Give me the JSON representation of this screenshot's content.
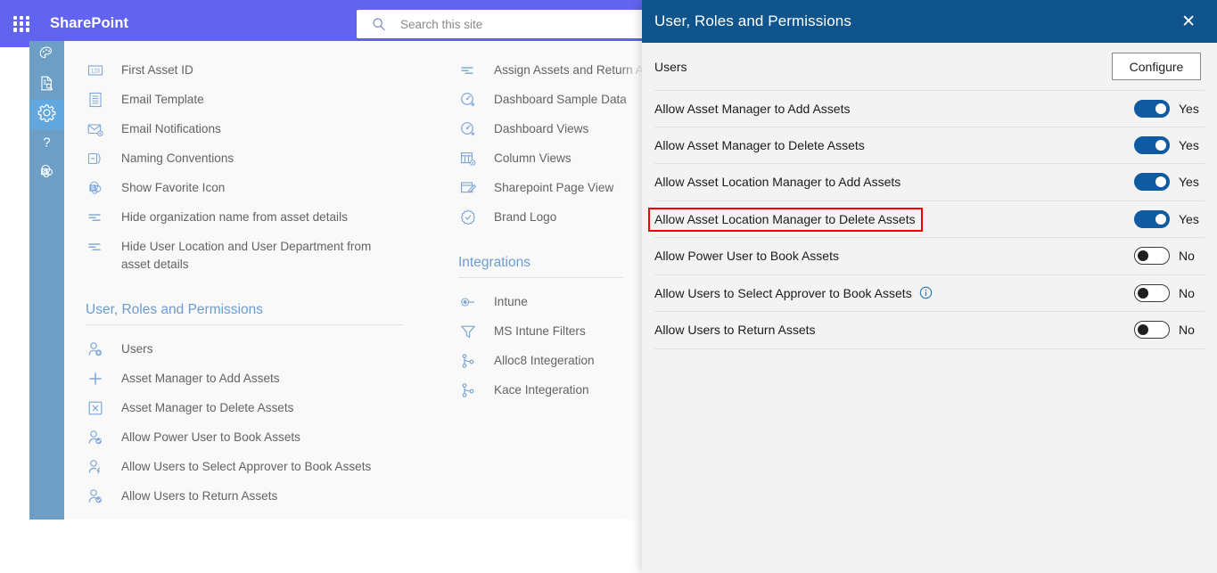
{
  "suite": {
    "waffle_label": "app-launcher",
    "brand": "SharePoint",
    "search_placeholder": "Search this site",
    "search_value": ""
  },
  "rail": {
    "items": [
      {
        "name": "theme-palette-icon",
        "label": "Theme"
      },
      {
        "name": "document-search-icon",
        "label": "Reports"
      },
      {
        "name": "gear-icon",
        "label": "Settings",
        "active": true
      },
      {
        "name": "question-mark-icon",
        "label": "Help"
      },
      {
        "name": "sharepoint-icon",
        "label": "SharePoint"
      }
    ]
  },
  "settings": {
    "column_a": {
      "items_top": [
        {
          "icon": "number-123-icon",
          "label": "First Asset ID"
        },
        {
          "icon": "email-template-icon",
          "label": "Email Template"
        },
        {
          "icon": "email-settings-icon",
          "label": "Email Notifications"
        },
        {
          "icon": "naming-conventions-icon",
          "label": "Naming Conventions"
        },
        {
          "icon": "sharepoint-favorite-icon",
          "label": "Show Favorite Icon"
        },
        {
          "icon": "hide-lines-icon",
          "label": "Hide organization name from asset details"
        },
        {
          "icon": "hide-lines-icon",
          "label": "Hide User Location and User Department from asset details",
          "wrap": true
        }
      ],
      "group_title": "User, Roles and Permissions",
      "items_group": [
        {
          "icon": "user-add-icon",
          "label": "Users"
        },
        {
          "icon": "plus-icon",
          "label": "Asset Manager to Add Assets"
        },
        {
          "icon": "box-x-icon",
          "label": "Asset Manager to Delete Assets"
        },
        {
          "icon": "user-check-icon",
          "label": "Allow Power User to Book Assets"
        },
        {
          "icon": "user-approver-icon",
          "label": "Allow Users to Select Approver to Book Assets"
        },
        {
          "icon": "user-check-icon",
          "label": "Allow Users to Return Assets"
        }
      ]
    },
    "column_b": {
      "items_top": [
        {
          "icon": "assign-lines-icon",
          "label": "Assign Assets and Return A"
        },
        {
          "icon": "dashboard-add-icon",
          "label": "Dashboard Sample Data"
        },
        {
          "icon": "dashboard-add-icon",
          "label": "Dashboard Views"
        },
        {
          "icon": "column-views-icon",
          "label": "Column Views"
        },
        {
          "icon": "page-edit-icon",
          "label": "Sharepoint Page View"
        },
        {
          "icon": "brand-badge-icon",
          "label": "Brand Logo"
        }
      ],
      "group_title": "Integrations",
      "items_group": [
        {
          "icon": "intune-icon",
          "label": "Intune"
        },
        {
          "icon": "filter-icon",
          "label": "MS Intune Filters"
        },
        {
          "icon": "branch-icon",
          "label": "Alloc8 Integeration"
        },
        {
          "icon": "branch-icon",
          "label": "Kace Integeration"
        }
      ]
    }
  },
  "panel": {
    "title": "User, Roles and Permissions",
    "close_label": "✕",
    "users_label": "Users",
    "configure_label": "Configure",
    "highlight_color": "#f20000",
    "toggle_on_color": "#0f5aa0",
    "rows": [
      {
        "label": "Allow Asset Manager to Add Assets",
        "state": "on",
        "state_text": "Yes",
        "info": false,
        "highlight": false
      },
      {
        "label": "Allow Asset Manager to Delete Assets",
        "state": "on",
        "state_text": "Yes",
        "info": false,
        "highlight": false
      },
      {
        "label": "Allow Asset Location Manager to Add Assets",
        "state": "on",
        "state_text": "Yes",
        "info": false,
        "highlight": false
      },
      {
        "label": "Allow Asset Location Manager to Delete Assets",
        "state": "on",
        "state_text": "Yes",
        "info": false,
        "highlight": true
      },
      {
        "label": "Allow Power User to Book Assets",
        "state": "off",
        "state_text": "No",
        "info": false,
        "highlight": false
      },
      {
        "label": "Allow Users to Select Approver to Book Assets",
        "state": "off",
        "state_text": "No",
        "info": true,
        "highlight": false
      },
      {
        "label": "Allow Users to Return Assets",
        "state": "off",
        "state_text": "No",
        "info": false,
        "highlight": false
      }
    ]
  }
}
